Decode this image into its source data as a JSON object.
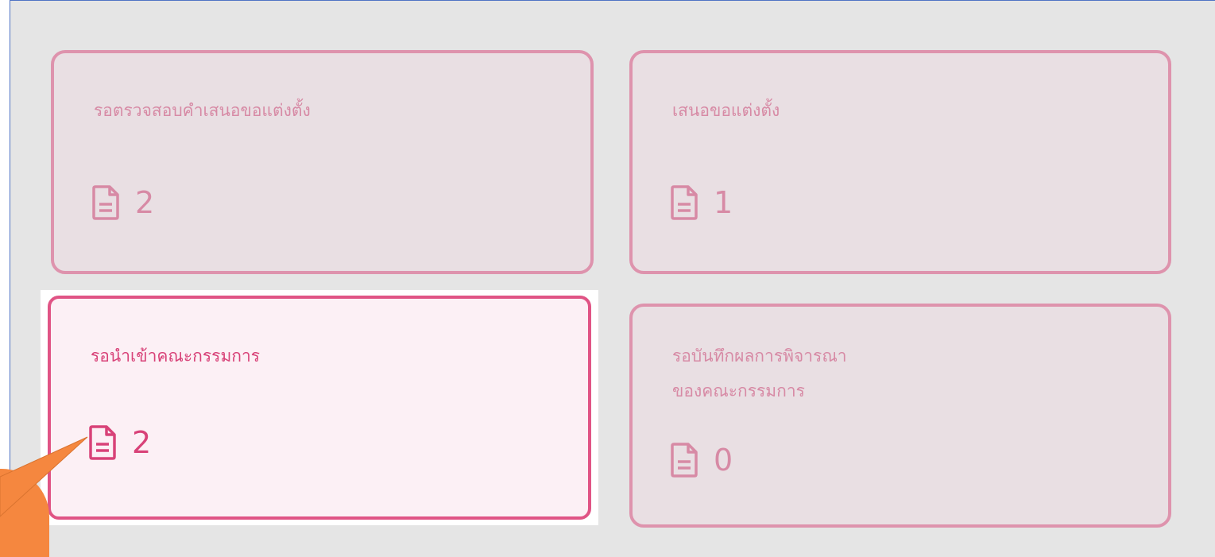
{
  "cards": [
    {
      "title": "รอตรวจสอบคำเสนอขอแต่งตั้ง",
      "count": "2",
      "icon": "document-icon"
    },
    {
      "title": "เสนอขอแต่งตั้ง",
      "count": "1",
      "icon": "document-icon"
    },
    {
      "title": "รอนำเข้าคณะกรรมการ",
      "count": "2",
      "icon": "document-icon"
    },
    {
      "title": "รอบันทึกผลการพิจารณา\nของคณะกรรมการ",
      "count": "0",
      "icon": "document-icon"
    }
  ],
  "colors": {
    "background": "#e5e5e5",
    "card_dim_fill": "#e9dfe3",
    "card_dim_border": "#de93ad",
    "card_active_fill": "#fcf0f5",
    "card_active_border": "#e05485",
    "callout": "#f5873f"
  }
}
